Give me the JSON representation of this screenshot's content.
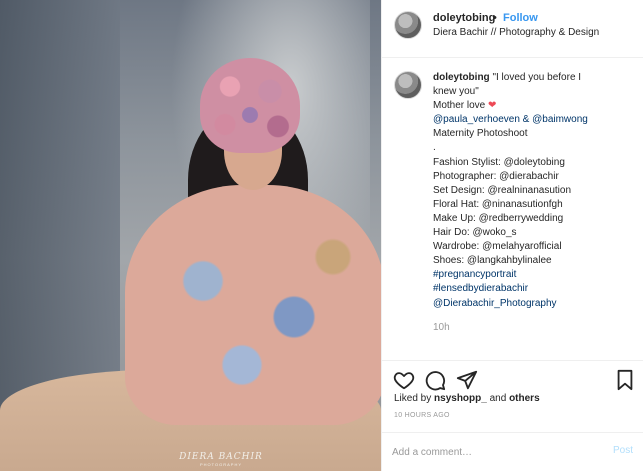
{
  "header": {
    "username": "doleytobing",
    "separator": "•",
    "follow_label": "Follow",
    "location": "Diera Bachir // Photography & Design",
    "more_icon": "···"
  },
  "photo": {
    "watermark_line1": "DIERA BACHIR",
    "watermark_line2": "PHOTOGRAPHY"
  },
  "caption": {
    "username": "doleytobing",
    "first_line": "\"I loved you before I",
    "lines": [
      "knew you\"",
      "Mother love",
      "@paula_verhoeven & @baimwong",
      "Maternity Photoshoot",
      ".",
      "Fashion Stylist: @doleytobing",
      "Photographer: @dierabachir",
      "Set Design: @realninanasution",
      "Floral Hat: @ninanasutionfgh",
      "Make Up: @redberrywedding",
      "Hair Do: @woko_s",
      "Wardrobe: @melahyarofficial",
      "Shoes: @langkahbylinalee",
      "#pregnancyportrait",
      "#lensedbydierabachir",
      "@Dierabachir_Photography"
    ],
    "heart": "❤",
    "time": "10h"
  },
  "actions": {
    "like_icon": "heart-icon",
    "comment_icon": "comment-icon",
    "share_icon": "share-icon",
    "save_icon": "bookmark-icon"
  },
  "likes": {
    "prefix": "Liked by",
    "user": "nsyshopp_",
    "middle": "and",
    "others": "others"
  },
  "posted_ago": "10 HOURS AGO",
  "comment_box": {
    "placeholder": "Add a comment…",
    "post_label": "Post"
  },
  "colors": {
    "accent": "#3897f0",
    "link": "#003569",
    "heart": "#ed4956",
    "muted": "#999999"
  }
}
